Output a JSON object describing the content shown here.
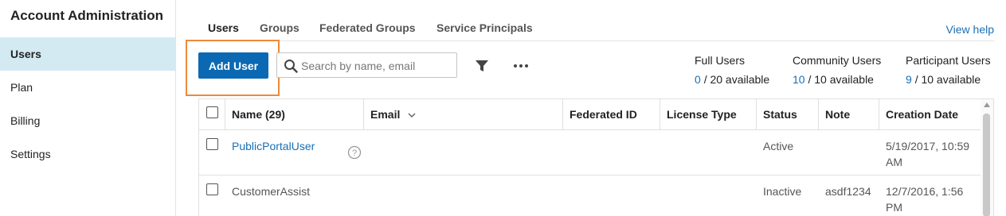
{
  "sidebar": {
    "title": "Account Administration",
    "items": [
      {
        "label": "Users",
        "active": true
      },
      {
        "label": "Plan"
      },
      {
        "label": "Billing"
      },
      {
        "label": "Settings"
      }
    ]
  },
  "tabs": [
    {
      "label": "Users",
      "active": true
    },
    {
      "label": "Groups"
    },
    {
      "label": "Federated Groups"
    },
    {
      "label": "Service Principals"
    }
  ],
  "view_help_label": "View help",
  "toolbar": {
    "add_user_label": "Add User",
    "search_placeholder": "Search by name, email",
    "search_value": "",
    "icons": [
      "search-icon",
      "filter-icon",
      "more-icon"
    ]
  },
  "licenses": [
    {
      "label": "Full Users",
      "used": "0",
      "total_text": "/ 20 available"
    },
    {
      "label": "Community Users",
      "used": "10",
      "total_text": "/ 10 available"
    },
    {
      "label": "Participant Users",
      "used": "9",
      "total_text": "/ 10 available"
    }
  ],
  "table": {
    "columns": [
      "Name (29)",
      "Email",
      "Federated ID",
      "License Type",
      "Status",
      "Note",
      "Creation Date"
    ],
    "rows": [
      {
        "name": "PublicPortalUser",
        "email": "",
        "federated_id": "",
        "license_type": "",
        "status": "Active",
        "note": "",
        "creation_date": "5/19/2017, 10:59 AM"
      },
      {
        "name": "CustomerAssist",
        "email": "",
        "federated_id": "",
        "license_type": "",
        "status": "Inactive",
        "note": "asdf1234",
        "creation_date": "12/7/2016, 1:56 PM"
      }
    ]
  },
  "colors": {
    "accent": "#0b69b3",
    "link": "#1a6fb5",
    "highlight": "#ee8a3a",
    "sidebar_active": "#d4eaf2"
  }
}
